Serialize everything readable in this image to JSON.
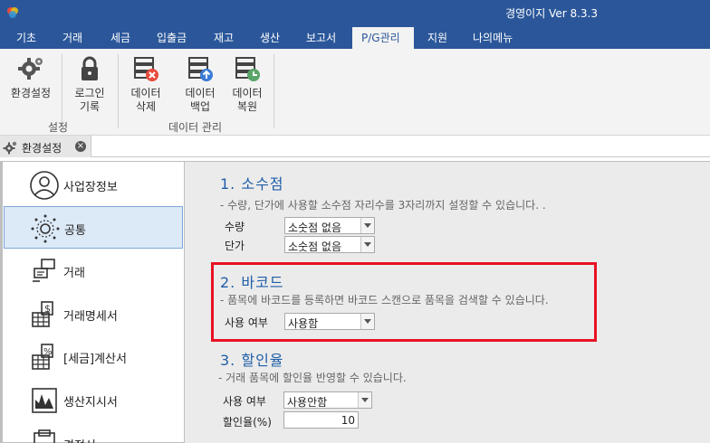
{
  "window": {
    "title": "경영이지 Ver 8.3.3"
  },
  "menu": {
    "tabs": [
      {
        "label": "기초"
      },
      {
        "label": "거래"
      },
      {
        "label": "세금"
      },
      {
        "label": "입출금"
      },
      {
        "label": "재고"
      },
      {
        "label": "생산"
      },
      {
        "label": "보고서"
      },
      {
        "label": "P/G관리"
      },
      {
        "label": "지원"
      },
      {
        "label": "나의메뉴"
      }
    ],
    "active_index": 7
  },
  "ribbon": {
    "settings_btn": "환경설정",
    "login_line1": "로그인",
    "login_line2": "기록",
    "group1_label": "설정",
    "delete_line1": "데이터",
    "delete_line2": "삭제",
    "backup_line1": "데이터",
    "backup_line2": "백업",
    "restore_line1": "데이터",
    "restore_line2": "복원",
    "group2_label": "데이터 관리"
  },
  "doc_tab": {
    "label": "환경설정",
    "close_glyph": "×"
  },
  "nav": {
    "items": [
      {
        "label": "사업장정보"
      },
      {
        "label": "공통"
      },
      {
        "label": "거래"
      },
      {
        "label": "거래명세서"
      },
      {
        "label": "[세금]계산서"
      },
      {
        "label": "생산지시서"
      },
      {
        "label": "견적서"
      }
    ],
    "active_index": 1
  },
  "section1": {
    "title": "1. 소수점",
    "desc": "- 수량, 단가에 사용할 소수점 자리수를 3자리까지 설정할 수 있습니다. .",
    "qty_label": "수량",
    "qty_value": "소숫점 없음",
    "price_label": "단가",
    "price_value": "소숫점 없음"
  },
  "section2": {
    "title": "2. 바코드",
    "desc": "- 품목에 바코드를 등록하면 바코드 스캔으로 품목을 검색할 수 있습니다.",
    "use_label": "사용 여부",
    "use_value": "사용함"
  },
  "section3": {
    "title": "3. 할인율",
    "desc": "- 거래 품목에 할인율 반영할 수 있습니다.",
    "use_label": "사용 여부",
    "use_value": "사용안함",
    "rate_label": "할인율(%)",
    "rate_value": "10"
  },
  "colors": {
    "accent": "#2b579a",
    "highlight": "#e81123",
    "section_title": "#1f5ea8"
  }
}
